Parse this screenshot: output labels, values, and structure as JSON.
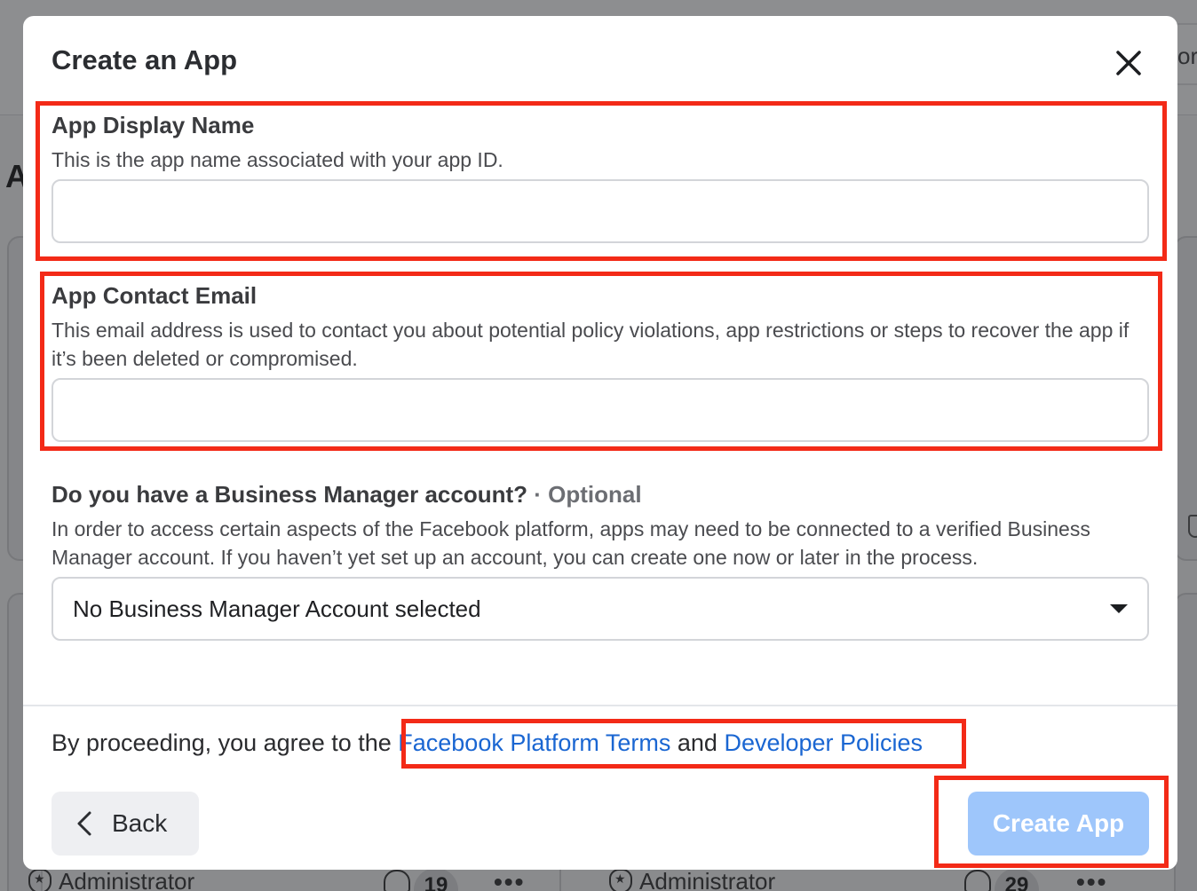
{
  "background": {
    "topbar_partial_text": "or",
    "heading_partial": "A",
    "cards": [
      {
        "role": "Administrator",
        "notifications": "19"
      },
      {
        "role": "Administrator",
        "notifications": "29"
      }
    ],
    "more_glyph": "•••"
  },
  "modal": {
    "title": "Create an App",
    "close_icon": "close-icon",
    "app_name": {
      "label": "App Display Name",
      "description": "This is the app name associated with your app ID.",
      "value": ""
    },
    "contact_email": {
      "label": "App Contact Email",
      "description": "This email address is used to contact you about potential policy violations, app restrictions or steps to recover the app if it’s been deleted or compromised.",
      "value": ""
    },
    "business_manager": {
      "label": "Do you have a Business Manager account?",
      "optional": " · Optional",
      "description": "In order to access certain aspects of the Facebook platform, apps may need to be connected to a verified Business Manager account. If you haven’t yet set up an account, you can create one now or later in the process.",
      "selected": "No Business Manager Account selected"
    },
    "agreement": {
      "prefix": "By proceeding, you agree to the ",
      "terms_link": "Facebook Platform Terms",
      "conjunction": " and ",
      "policies_link": "Developer Policies"
    },
    "back_label": "Back",
    "create_label": "Create App",
    "colors": {
      "link": "#1a66d2",
      "create_button_disabled": "#9ec6fb",
      "highlight": "#f32a17"
    }
  }
}
